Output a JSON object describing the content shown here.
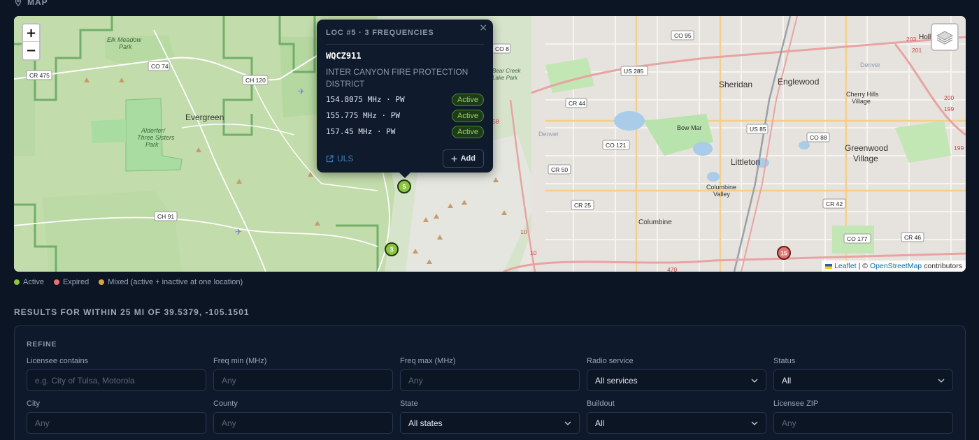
{
  "section": {
    "title": "MAP",
    "icon": "map-pin-icon"
  },
  "map": {
    "zoom_in": "+",
    "zoom_out": "−",
    "places": [
      "Evergreen",
      "Alderfer/",
      "Three Sisters",
      "Park",
      "Elk Meadow",
      "Park",
      "Sheridan",
      "Englewood",
      "Cherry Hills",
      "Village",
      "Bow Mar",
      "Greenwood",
      "Village",
      "Littleton",
      "Columbine",
      "Valley",
      "Columbine",
      "Denver",
      "Denver",
      "Bear Creek",
      "Lake Park"
    ],
    "roads": [
      "CR 475",
      "CO 74",
      "CH 120",
      "CO 8",
      "CO 95",
      "US 285",
      "CR 44",
      "US 85",
      "CO 88",
      "CO 121",
      "CR 50",
      "CR 25",
      "CH 91",
      "CR 42",
      "CO 177",
      "CR 46",
      "203",
      "201",
      "200",
      "199",
      "199",
      "58",
      "10",
      "10",
      "470",
      "Holly H"
    ],
    "markers": [
      {
        "label": "5",
        "status": "active"
      },
      {
        "label": "3",
        "status": "active"
      },
      {
        "label": "15",
        "status": "expired"
      }
    ],
    "attribution": {
      "leaflet": "Leaflet",
      "sep": "| ©",
      "osm": "OpenStreetMap",
      "rest": "contributors"
    }
  },
  "popup": {
    "close": "×",
    "title": "LOC #5 · 3 FREQUENCIES",
    "callsign": "WQCZ911",
    "licensee": "INTER CANYON FIRE PROTECTION DISTRICT",
    "frequencies": [
      {
        "freq": "154.8075 MHz · PW",
        "status": "Active"
      },
      {
        "freq": "155.775 MHz · PW",
        "status": "Active"
      },
      {
        "freq": "157.45 MHz · PW",
        "status": "Active"
      }
    ],
    "uls_label": "ULS",
    "add_label": "Add"
  },
  "legend": [
    {
      "label": "Active",
      "color": "#8cc63f"
    },
    {
      "label": "Expired",
      "color": "#e57373"
    },
    {
      "label": "Mixed (active + inactive at one location)",
      "color": "#d9a441"
    }
  ],
  "results_title": "RESULTS FOR WITHIN 25 MI OF 39.5379, -105.1501",
  "refine": {
    "title": "REFINE",
    "fields": [
      {
        "label": "Licensee contains",
        "placeholder": "e.g. City of Tulsa, Motorola",
        "type": "input"
      },
      {
        "label": "Freq min (MHz)",
        "placeholder": "Any",
        "type": "input"
      },
      {
        "label": "Freq max (MHz)",
        "placeholder": "Any",
        "type": "input"
      },
      {
        "label": "Radio service",
        "value": "All services",
        "type": "select"
      },
      {
        "label": "Status",
        "value": "All",
        "type": "select"
      },
      {
        "label": "City",
        "placeholder": "Any",
        "type": "input"
      },
      {
        "label": "County",
        "placeholder": "Any",
        "type": "input"
      },
      {
        "label": "State",
        "value": "All states",
        "type": "select"
      },
      {
        "label": "Buildout",
        "value": "All",
        "type": "select"
      },
      {
        "label": "Licensee ZIP",
        "placeholder": "Any",
        "type": "input"
      }
    ]
  },
  "colors": {
    "background": "#0b1524",
    "panel": "#0e1a2c",
    "active": "#8cc63f",
    "expired": "#e57373",
    "mixed": "#d9a441",
    "link": "#3f7fb8"
  }
}
